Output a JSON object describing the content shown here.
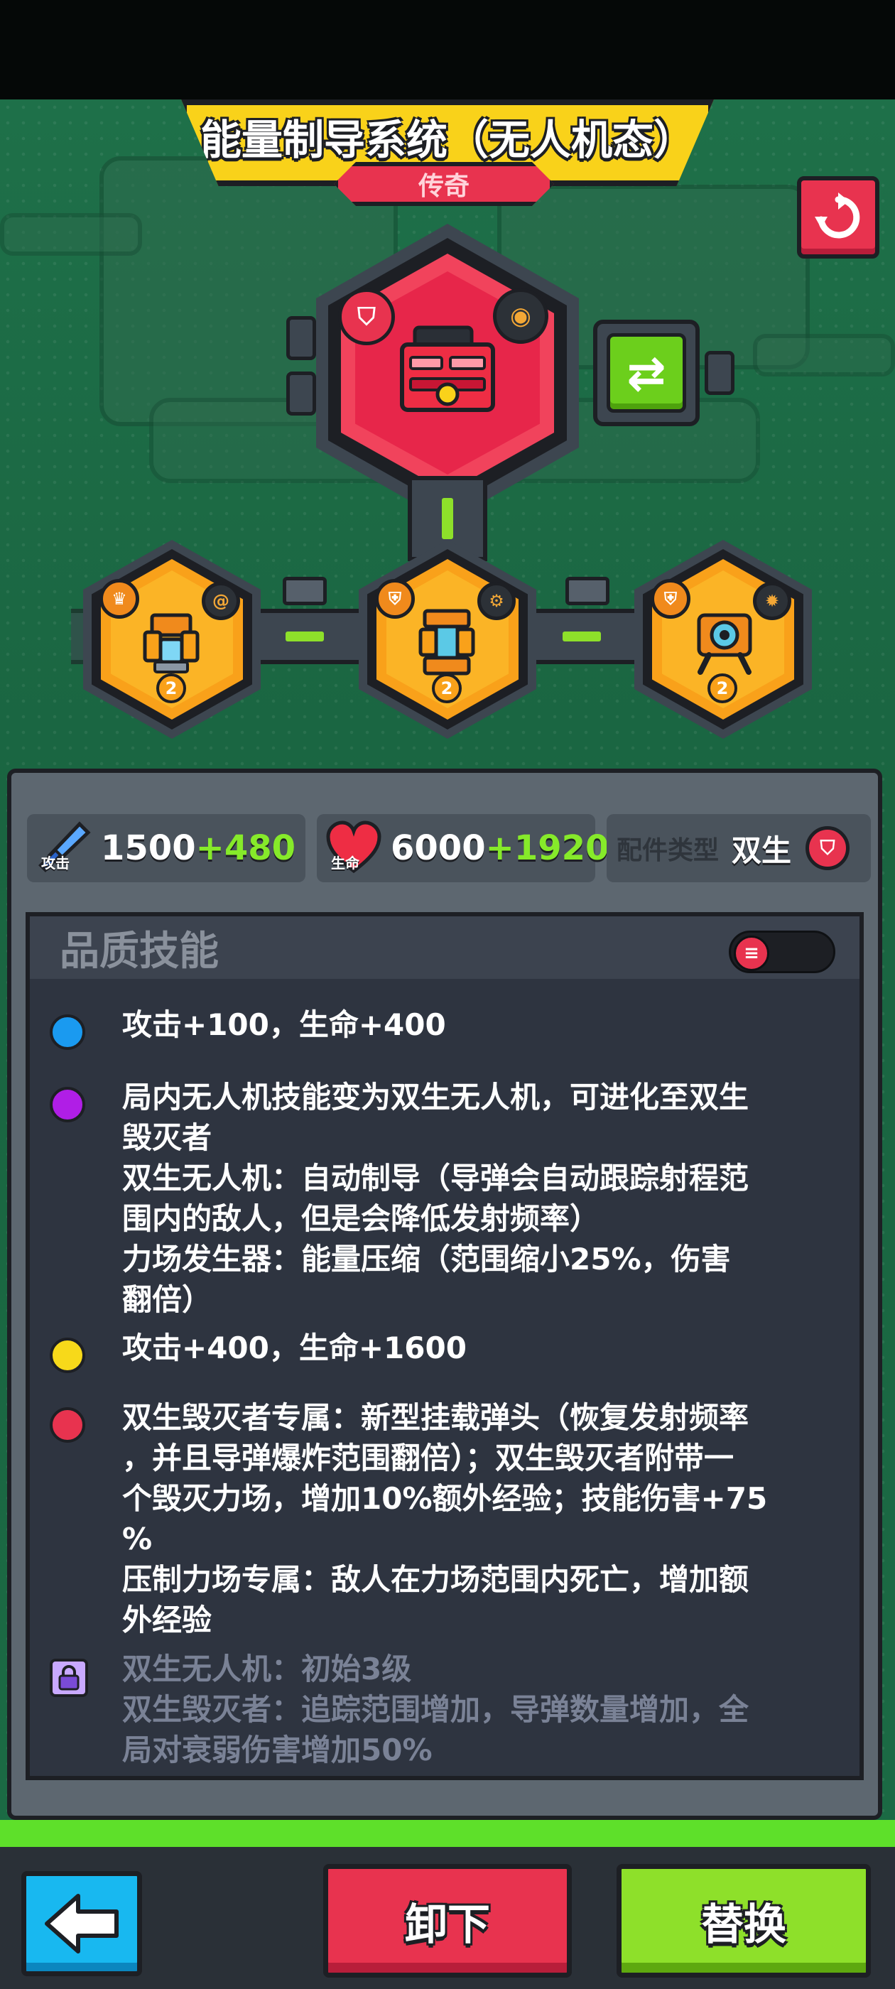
{
  "header": {
    "title": "能量制导系统（无人机态）",
    "rarity": "传奇"
  },
  "stats": {
    "attack": {
      "icon_label": "攻击",
      "value": "1500",
      "bonus": "+480"
    },
    "health": {
      "icon_label": "生命",
      "value": "6000",
      "bonus": "+1920"
    },
    "part_type": {
      "label": "配件类型",
      "value": "双生"
    }
  },
  "slots": [
    {
      "level": "2"
    },
    {
      "level": "2"
    },
    {
      "level": "2"
    }
  ],
  "quality_skills": {
    "title": "品质技能",
    "items": [
      {
        "color": "#1a9af0",
        "text": "攻击+100，生命+400"
      },
      {
        "color": "#b01ee6",
        "text": "局内无人机技能变为双生无人机，可进化至双生\n毁灭者\n双生无人机：自动制导（导弹会自动跟踪射程范\n围内的敌人，但是会降低发射频率）\n力场发生器：能量压缩（范围缩小25%，伤害\n翻倍）"
      },
      {
        "color": "#f7d91a",
        "text": "攻击+400，生命+1600"
      },
      {
        "color": "#e8334f",
        "text": "双生毁灭者专属：新型挂载弹头（恢复发射频率\n，并且导弹爆炸范围翻倍）；双生毁灭者附带一\n个毁灭力场，增加10%额外经验；技能伤害+75\n%\n压制力场专属：敌人在力场范围内死亡，增加额\n外经验"
      },
      {
        "locked": true,
        "text": "双生无人机：初始3级\n双生毁灭者：追踪范围增加，导弹数量增加，全\n局对衰弱伤害增加50%"
      }
    ]
  },
  "buttons": {
    "unequip": "卸下",
    "replace": "替换"
  },
  "colors": {
    "legendary_red": "#e8334f",
    "banner_yellow": "#f9d21a",
    "accent_green": "#8ee02a",
    "background_green": "#1c6a45"
  }
}
